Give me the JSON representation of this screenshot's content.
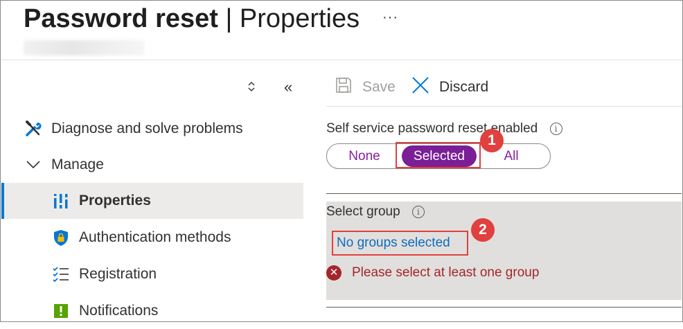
{
  "header": {
    "title_bold": "Password reset",
    "title_sep": " | ",
    "title_rest": "Properties",
    "more_label": "···"
  },
  "sidebar": {
    "sort_icon": "updown-icon",
    "collapse_label": "«",
    "items": [
      {
        "label": "Diagnose and solve problems",
        "icon": "wrench-icon"
      },
      {
        "label": "Manage",
        "icon": "chevron-down-icon"
      },
      {
        "label": "Properties",
        "icon": "properties-icon",
        "active": true
      },
      {
        "label": "Authentication methods",
        "icon": "shield-icon"
      },
      {
        "label": "Registration",
        "icon": "checklist-icon"
      },
      {
        "label": "Notifications",
        "icon": "notification-icon"
      }
    ]
  },
  "toolbar": {
    "save_label": "Save",
    "discard_label": "Discard"
  },
  "sspr": {
    "label": "Self service password reset enabled",
    "options": [
      "None",
      "Selected",
      "All"
    ],
    "selected": "Selected"
  },
  "group": {
    "label": "Select group",
    "link_text": "No groups selected",
    "error_text": "Please select at least one group"
  },
  "callouts": [
    "1",
    "2"
  ],
  "colors": {
    "accent": "#0078d4",
    "pill_selected": "#7a1f96",
    "callout_red": "#e0403e",
    "error": "#a4262c",
    "link": "#0f6cbd"
  }
}
